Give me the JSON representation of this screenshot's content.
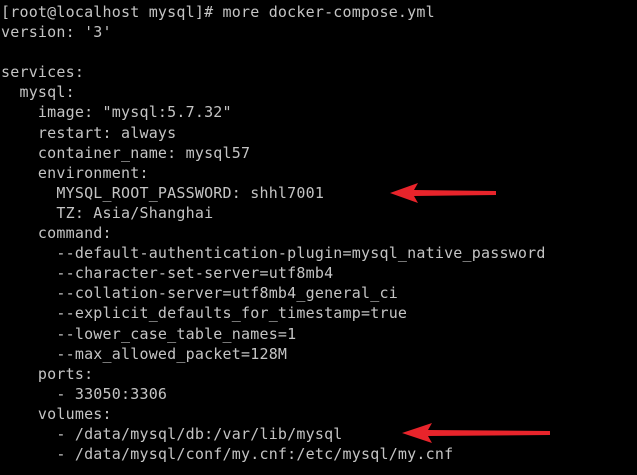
{
  "terminal": {
    "lines": [
      "[root@localhost mysql]# more docker-compose.yml",
      "version: '3'",
      "",
      "services:",
      "  mysql:",
      "    image: \"mysql:5.7.32\"",
      "    restart: always",
      "    container_name: mysql57",
      "    environment:",
      "      MYSQL_ROOT_PASSWORD: shhl7001",
      "      TZ: Asia/Shanghai",
      "    command:",
      "      --default-authentication-plugin=mysql_native_password",
      "      --character-set-server=utf8mb4",
      "      --collation-server=utf8mb4_general_ci",
      "      --explicit_defaults_for_timestamp=true",
      "      --lower_case_table_names=1",
      "      --max_allowed_packet=128M",
      "    ports:",
      "      - 33050:3306",
      "    volumes:",
      "      - /data/mysql/db:/var/lib/mysql",
      "      - /data/mysql/conf/my.cnf:/etc/mysql/my.cnf"
    ]
  },
  "colors": {
    "background": "#000000",
    "text": "#c4c4c4",
    "arrow": "#e8242b"
  },
  "annotations": [
    {
      "icon": "red-arrow-icon",
      "points_to_line": 9
    },
    {
      "icon": "red-arrow-icon",
      "points_to_line": 21
    }
  ]
}
